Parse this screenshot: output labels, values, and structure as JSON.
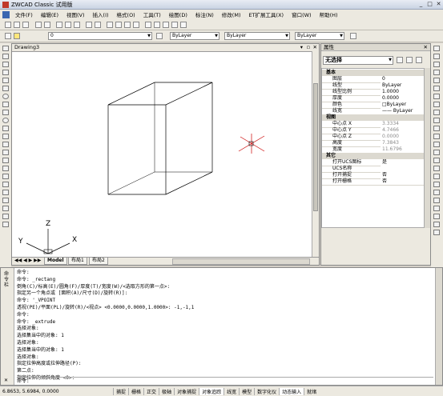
{
  "window": {
    "title": "ZWCAD Classic 试用版",
    "minimize": "_",
    "maximize": "□",
    "close": "✕"
  },
  "menu": [
    "文件(F)",
    "编辑(E)",
    "视图(V)",
    "插入(I)",
    "格式(O)",
    "工具(T)",
    "绘图(D)",
    "标注(N)",
    "修改(M)",
    "ET扩展工具(X)",
    "窗口(W)",
    "帮助(H)"
  ],
  "layer_combo": "0",
  "color_combo": "ByLayer",
  "linetype_combo": "ByLayer",
  "lineweight_combo": "ByLayer",
  "document": {
    "title": "Drawing3",
    "tabs": [
      "Model",
      "布局1",
      "布局2"
    ],
    "ucs": {
      "x": "X",
      "y": "Y",
      "z": "Z"
    }
  },
  "properties": {
    "title": "属性",
    "selection": "无选择",
    "sections": [
      {
        "name": "基本",
        "rows": [
          {
            "k": "图层",
            "v": "0"
          },
          {
            "k": "线型",
            "v": "ByLayer"
          },
          {
            "k": "线型比例",
            "v": "1.0000"
          },
          {
            "k": "厚度",
            "v": "0.0000"
          },
          {
            "k": "颜色",
            "v": "□ByLayer"
          },
          {
            "k": "线宽",
            "v": "—— ByLayer"
          }
        ]
      },
      {
        "name": "视图",
        "rows": [
          {
            "k": "中心点 X",
            "v": "3.3334",
            "grey": true
          },
          {
            "k": "中心点 Y",
            "v": "4.7466",
            "grey": true
          },
          {
            "k": "中心点 Z",
            "v": "0.0000",
            "grey": true
          },
          {
            "k": "高度",
            "v": "7.3843",
            "grey": true
          },
          {
            "k": "宽度",
            "v": "11.6796",
            "grey": true
          }
        ]
      },
      {
        "name": "其它",
        "rows": [
          {
            "k": "打开UCS图标",
            "v": "是"
          },
          {
            "k": "UCS名称",
            "v": ""
          },
          {
            "k": "打开捕捉",
            "v": "否"
          },
          {
            "k": "打开栅格",
            "v": "否"
          }
        ]
      }
    ]
  },
  "command": {
    "side_label": "命令栏",
    "lines": [
      "命令:",
      "命令: _rectang",
      "倒角(C)/标高(E)/圆角(F)/厚度(T)/宽度(W)/<选取方形的第一点>:",
      "指定另一个角点或 [面积(A)/尺寸(D)/旋转(R)]:",
      "命令: '_VPOINT",
      "透视(PE)/平面(PL)/旋转(R)/<视点> <0.0000,0.0000,1.0000>: -1,-1,1",
      "命令:",
      "命令: _extrude",
      "选择对象:",
      "选择集当中的对象: 1",
      "选择对象:",
      "选择集当中的对象: 1",
      "选择对象:",
      "指定拉伸高度或拉伸路径(P):",
      "第二点:",
      "指定拉伸的倾斜角度 <0>:"
    ],
    "prompt": "命令:"
  },
  "status": {
    "coords": "6.8653, 5.6984, 0.0000",
    "buttons": [
      "捕捉",
      "栅格",
      "正交",
      "极轴",
      "对象捕捉",
      "对象追踪",
      "线宽",
      "模型",
      "数字化仪",
      "动态输入",
      "就绪"
    ]
  },
  "icons": [
    "new-icon",
    "open-icon",
    "save-icon",
    "print-icon",
    "cut-icon",
    "copy-icon",
    "paste-icon",
    "undo-icon",
    "redo-icon",
    "pan-icon",
    "zoom-icon",
    "layer-icon",
    "line-icon",
    "circle-icon",
    "arc-icon",
    "rectangle-icon",
    "move-icon",
    "rotate-icon",
    "scale-icon",
    "trim-icon"
  ]
}
